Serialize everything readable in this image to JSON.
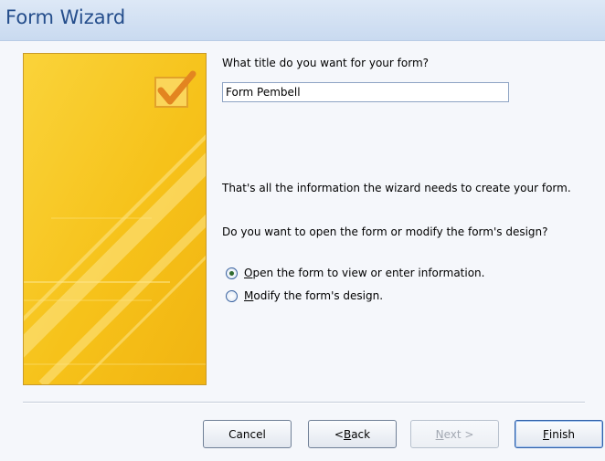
{
  "window": {
    "title": "Form Wizard"
  },
  "main": {
    "title_question": "What title do you want for your form?",
    "title_value": "Form Pembell",
    "info_line": "That's all the information the wizard needs to create your form.",
    "open_question": "Do you want to open the form or modify the form's design?",
    "options": [
      {
        "mnemonic": "O",
        "rest": "pen the form to view or enter information.",
        "selected": true
      },
      {
        "mnemonic": "M",
        "rest": "odify the form's design.",
        "selected": false
      }
    ]
  },
  "buttons": {
    "cancel": "Cancel",
    "back_prefix": "< ",
    "back_mnemonic": "B",
    "back_rest": "ack",
    "next_prefix": "",
    "next_mnemonic": "N",
    "next_rest": "ext >",
    "finish_prefix": "",
    "finish_mnemonic": "F",
    "finish_rest": "inish"
  },
  "icons": {
    "banner_checkbox": "checkmark-checkbox-icon",
    "radio_selected": "radio-selected-icon",
    "radio_unselected": "radio-unselected-icon"
  },
  "colors": {
    "title_text": "#254e8c",
    "banner_yellow": "#f7c81c",
    "banner_check": "#e08a1e"
  }
}
